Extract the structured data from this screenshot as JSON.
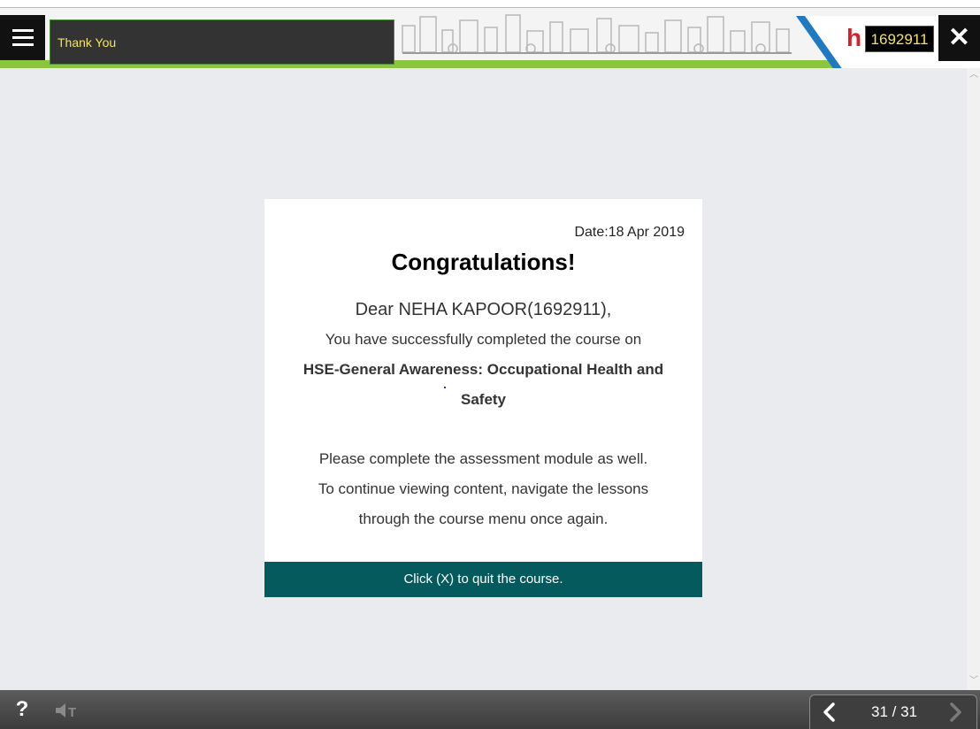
{
  "header": {
    "slide_title": "Thank You",
    "user_id": "1692911",
    "logo_letter": "h"
  },
  "card": {
    "date": "Date:18 Apr 2019",
    "heading": "Congratulations!",
    "greeting": "Dear NEHA KAPOOR(1692911),",
    "completed_text": "You have successfully completed the course on",
    "course_name_line1": "HSE-General Awareness: Occupational Health and",
    "course_name_line2": "Safety",
    "instruction_line1": "Please complete the assessment module as well.",
    "instruction_line2": "To continue viewing content, navigate the lessons",
    "instruction_line3": "through the course menu once again.",
    "footer": "Click (X) to quit the course."
  },
  "bottom_bar": {
    "help_label": "?",
    "page_counter": "31 / 31"
  },
  "icons": {
    "menu": "hamburger-menu-icon",
    "close": "close-icon",
    "help": "help-icon",
    "audio": "audio-muted-icon",
    "prev": "chevron-left-icon",
    "next": "chevron-right-icon"
  },
  "colors": {
    "title_text": "#f6e35b",
    "card_footer_bg": "#045a5d",
    "green_strip": "#8cc63f",
    "logo_red": "#d42027",
    "accent_blue": "#1f7ac2"
  }
}
